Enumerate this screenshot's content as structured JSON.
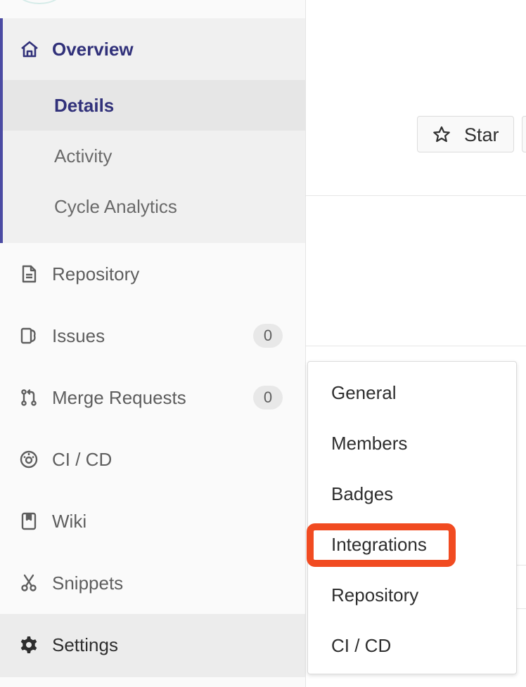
{
  "sidebar": {
    "overview": {
      "label": "Overview",
      "icon": "home-icon",
      "subitems": [
        {
          "label": "Details",
          "active": true
        },
        {
          "label": "Activity",
          "active": false
        },
        {
          "label": "Cycle Analytics",
          "active": false
        }
      ]
    },
    "items": [
      {
        "label": "Repository",
        "icon": "document-icon"
      },
      {
        "label": "Issues",
        "icon": "issues-icon",
        "count": "0"
      },
      {
        "label": "Merge Requests",
        "icon": "merge-request-icon",
        "count": "0"
      },
      {
        "label": "CI / CD",
        "icon": "rocket-icon"
      },
      {
        "label": "Wiki",
        "icon": "book-icon"
      },
      {
        "label": "Snippets",
        "icon": "scissors-icon"
      },
      {
        "label": "Settings",
        "icon": "gear-icon"
      }
    ]
  },
  "header": {
    "star_label": "Star"
  },
  "settings_menu": {
    "items": [
      "General",
      "Members",
      "Badges",
      "Integrations",
      "Repository",
      "CI / CD"
    ],
    "highlighted": "Integrations"
  },
  "colors": {
    "accent": "#31317a",
    "active_border": "#4b4ba3",
    "highlight_border": "#f14b21"
  }
}
